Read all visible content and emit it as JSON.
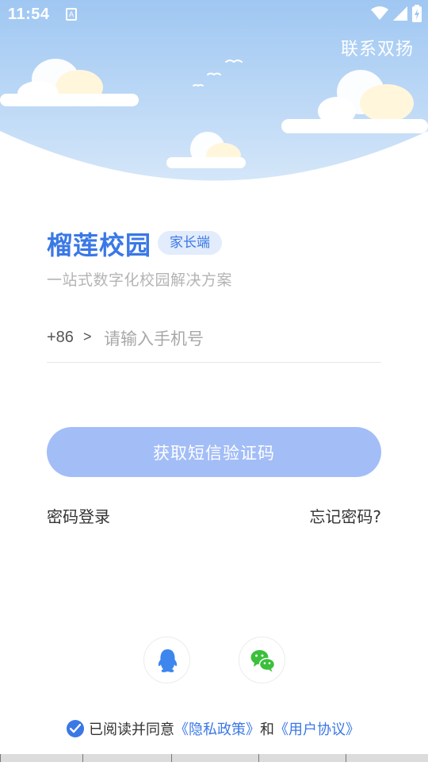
{
  "status_bar": {
    "time": "11:54",
    "app_icon_glyph": "A"
  },
  "header": {
    "contact_label": "联系双扬"
  },
  "brand": {
    "title": "榴莲校园",
    "badge": "家长端",
    "subtitle": "一站式数字化校园解决方案"
  },
  "phone": {
    "country_code": "+86",
    "arrow": ">",
    "placeholder": "请输入手机号",
    "value": ""
  },
  "actions": {
    "sms_button_label": "获取短信验证码",
    "password_login_label": "密码登录",
    "forgot_password_label": "忘记密码?"
  },
  "social": {
    "qq_icon": "qq-penguin-icon",
    "wechat_icon": "wechat-icon"
  },
  "agreement": {
    "checked": true,
    "prefix": "已阅读并同意",
    "privacy_link": "《隐私政策》",
    "conjunction": "和",
    "terms_link": "《用户协议》"
  },
  "colors": {
    "accent": "#3a78e6",
    "button_disabled": "#a3bdf7",
    "sky_top": "#9fc7f2",
    "sky_bottom": "#cfe3f8",
    "qq_blue": "#3d86ee",
    "wechat_green": "#3bc03b"
  }
}
